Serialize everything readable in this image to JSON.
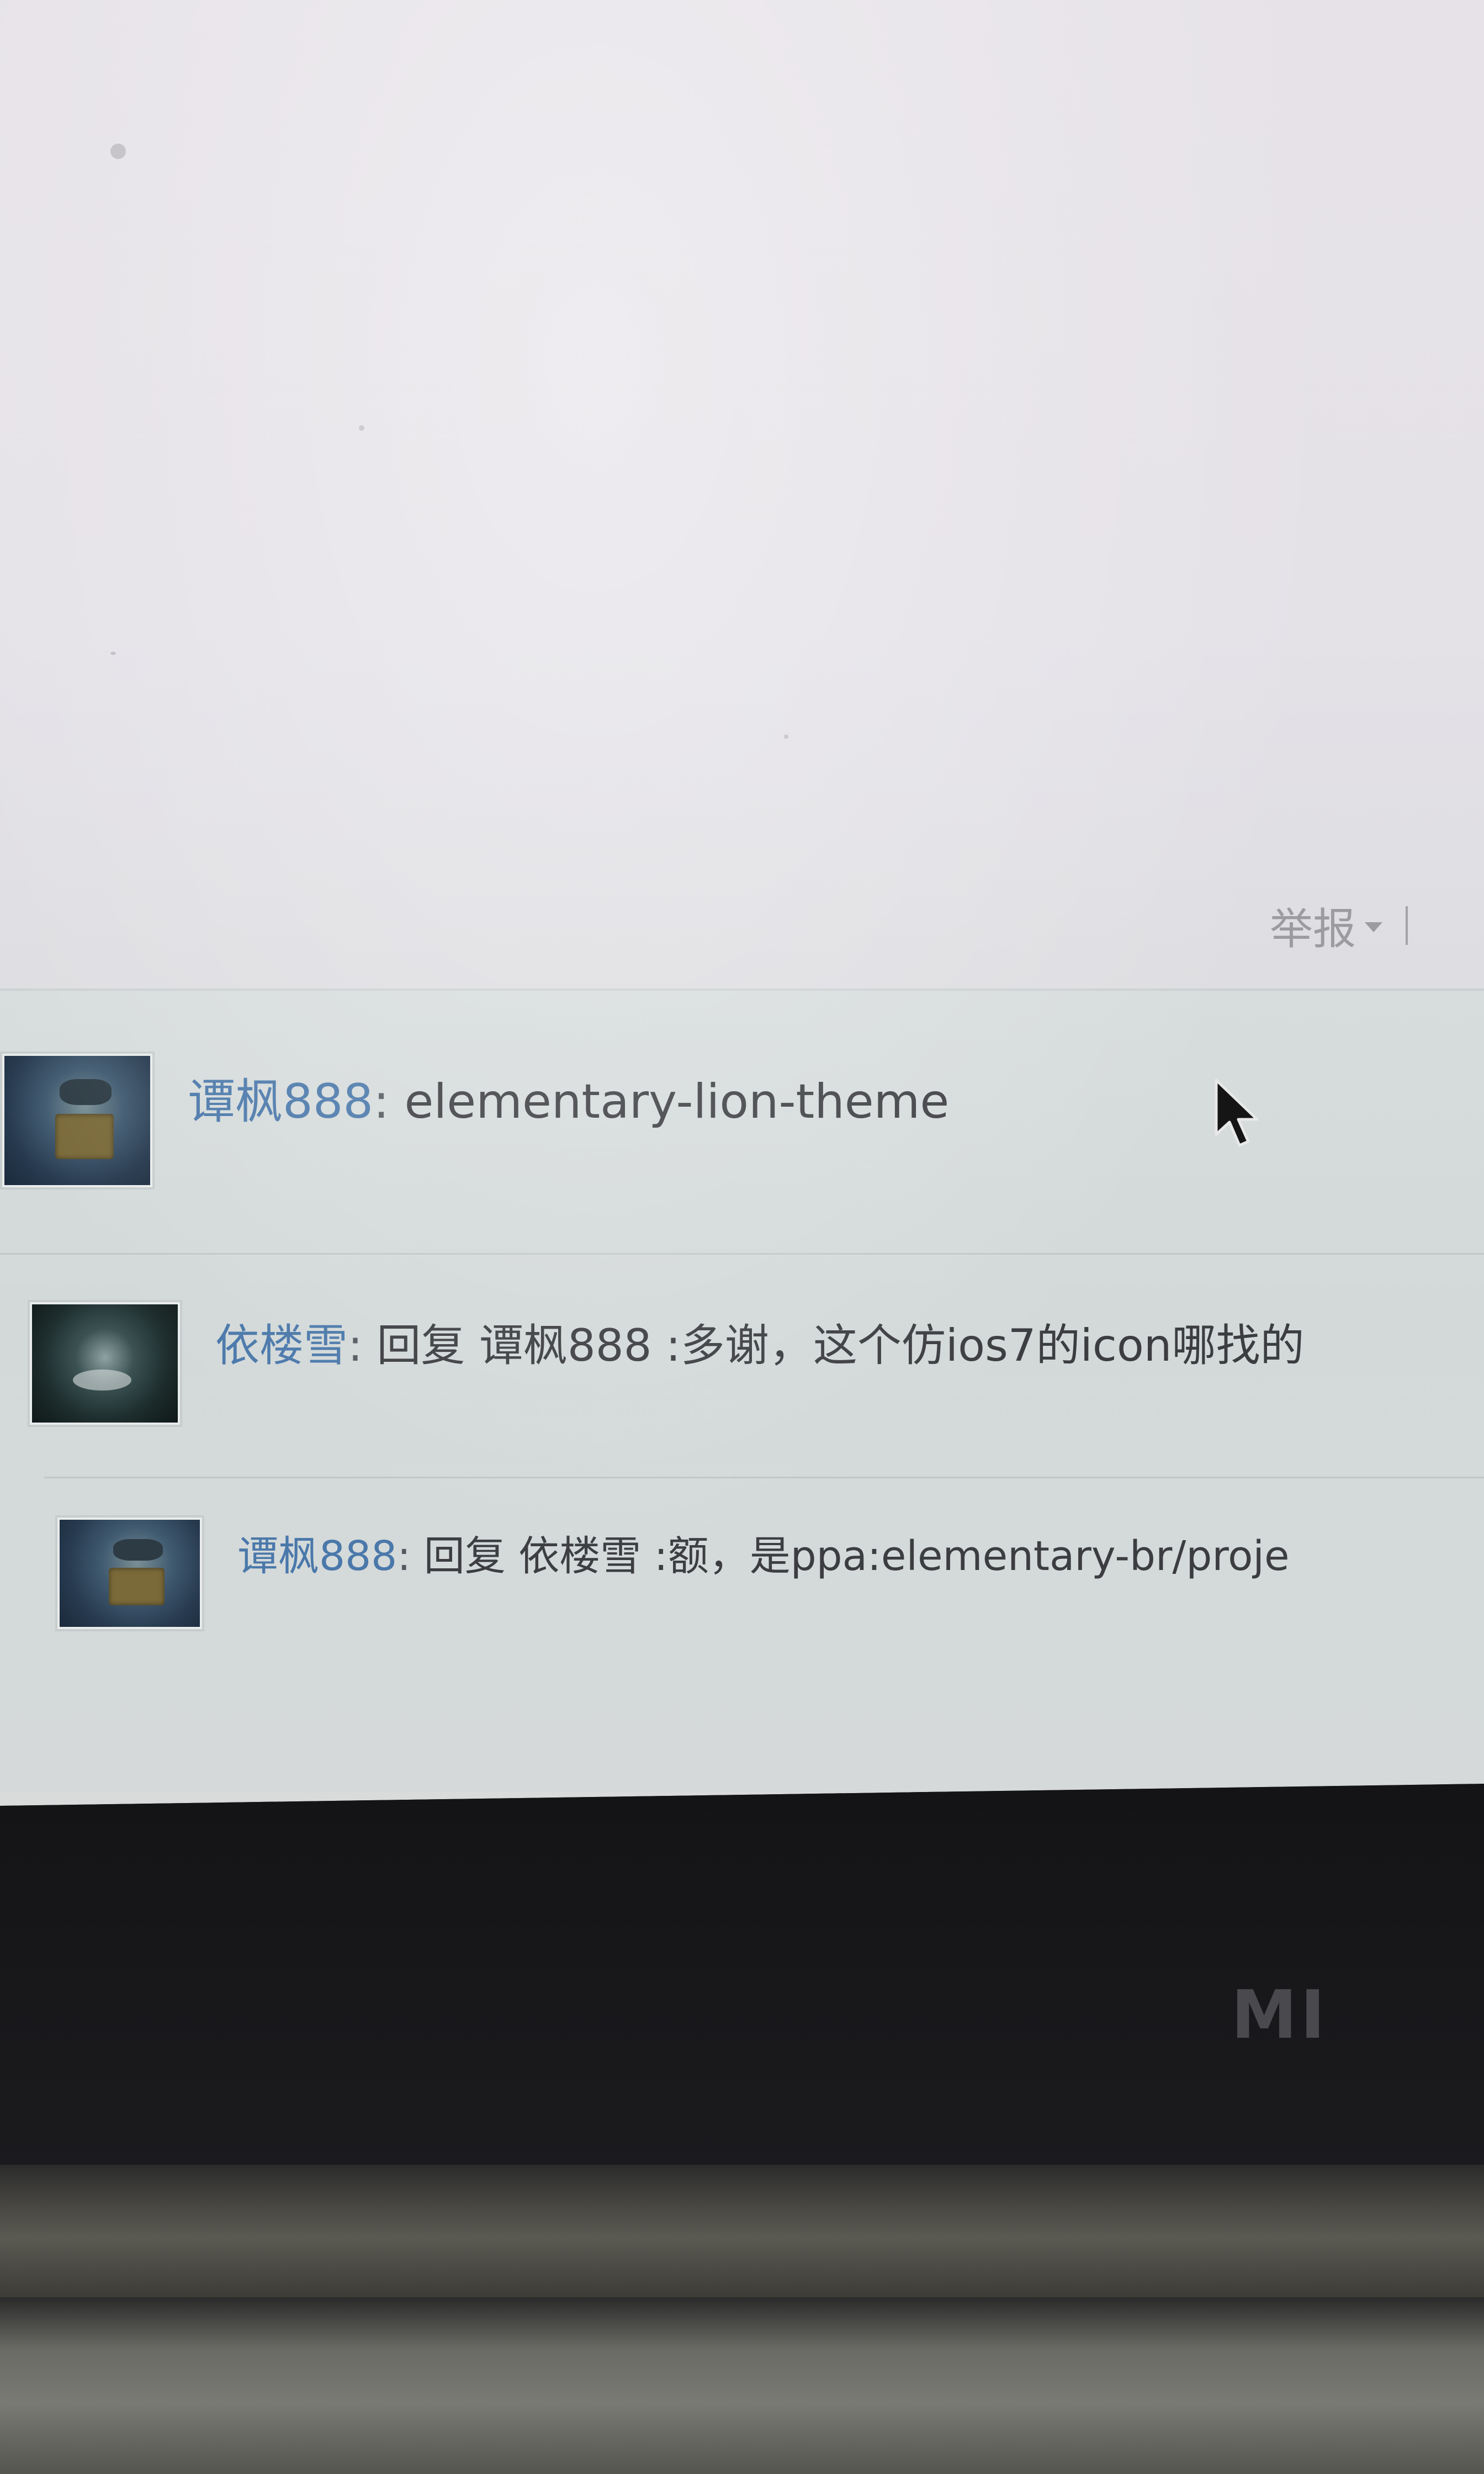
{
  "report": {
    "label": "举报",
    "separator": "|"
  },
  "comments": [
    {
      "avatar": "robot-avatar",
      "username": "谭枫888",
      "colon": ":",
      "text": "elementary-lion-theme"
    },
    {
      "avatar": "dark-avatar",
      "username": "依楼雪",
      "colon": ":",
      "text": "回复 谭枫888 :多谢，这个仿ios7的icon哪找的"
    },
    {
      "avatar": "robot-avatar",
      "username": "谭枫888",
      "colon": ":",
      "text": "回复 依楼雪 :额，是ppa:elementary-br/proje"
    }
  ],
  "laptop": {
    "brand": "MI"
  },
  "colors": {
    "username": "#4a78aa",
    "text": "#3b3d41",
    "report": "#9b9ba0",
    "bezel": "#18181b"
  },
  "icons": [
    "mouse-cursor-icon",
    "chevron-down-icon"
  ]
}
